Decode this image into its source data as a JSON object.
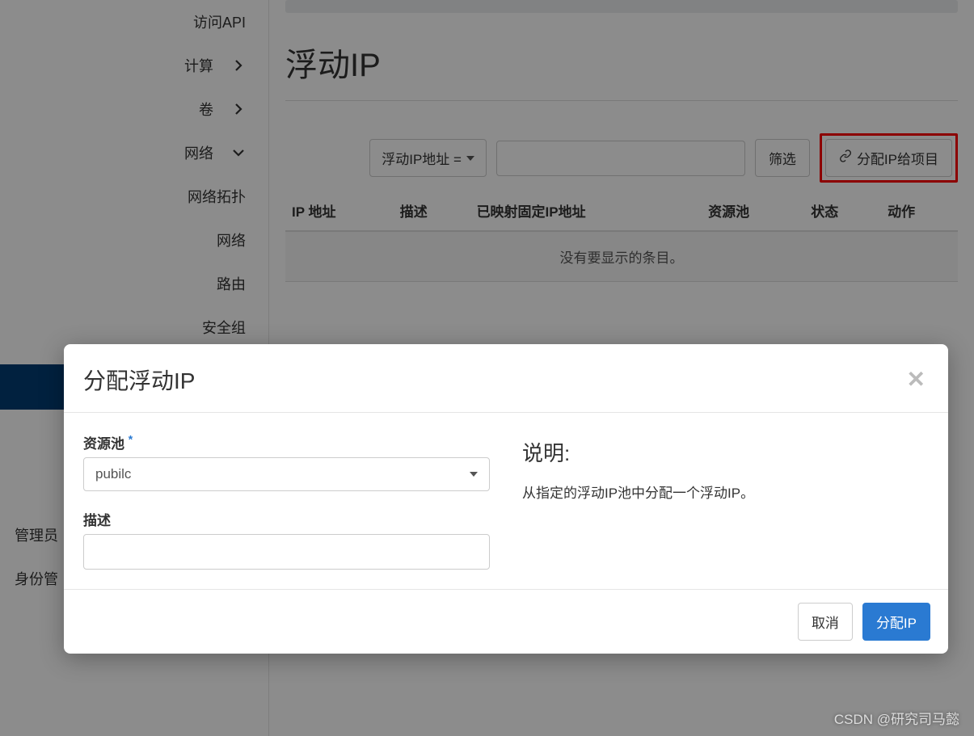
{
  "sidebar": {
    "items": [
      {
        "label": "访问API",
        "chevron": ""
      },
      {
        "label": "计算",
        "chevron": "right"
      },
      {
        "label": "卷",
        "chevron": "right"
      },
      {
        "label": "网络",
        "chevron": "down"
      }
    ],
    "network_subitems": [
      {
        "label": "网络拓扑"
      },
      {
        "label": "网络"
      },
      {
        "label": "路由"
      },
      {
        "label": "安全组"
      }
    ],
    "lower_items": [
      {
        "label": "管理员"
      },
      {
        "label": "身份管"
      }
    ]
  },
  "page": {
    "title": "浮动IP"
  },
  "toolbar": {
    "filter_dropdown_label": "浮动IP地址 = ",
    "filter_button_label": "筛选",
    "allocate_button_label": "分配IP给项目"
  },
  "table": {
    "headers": [
      "IP 地址",
      "描述",
      "已映射固定IP地址",
      "资源池",
      "状态",
      "动作"
    ],
    "empty_text": "没有要显示的条目。"
  },
  "modal": {
    "title": "分配浮动IP",
    "pool_label": "资源池",
    "pool_value": "pubilc",
    "desc_label": "描述",
    "explain_title": "说明:",
    "explain_text": "从指定的浮动IP池中分配一个浮动IP。",
    "cancel_label": "取消",
    "submit_label": "分配IP"
  },
  "watermark": "CSDN @研究司马懿"
}
